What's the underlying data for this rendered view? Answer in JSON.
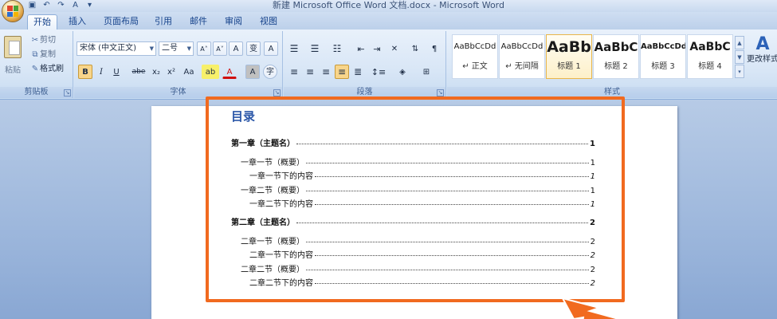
{
  "window": {
    "title": "新建 Microsoft Office Word 文档.docx - Microsoft Word"
  },
  "qat": [
    {
      "icon": "save-icon",
      "glyph": "▣"
    },
    {
      "icon": "undo-icon",
      "glyph": "↶"
    },
    {
      "icon": "redo-icon",
      "glyph": "↷"
    },
    {
      "icon": "spelling-icon",
      "glyph": "A"
    },
    {
      "icon": "customize-icon",
      "glyph": "▾"
    }
  ],
  "tabs": [
    {
      "label": "开始"
    },
    {
      "label": "插入"
    },
    {
      "label": "页面布局"
    },
    {
      "label": "引用"
    },
    {
      "label": "邮件"
    },
    {
      "label": "审阅"
    },
    {
      "label": "视图"
    }
  ],
  "clipboard": {
    "paste": "粘贴",
    "cut": "剪切",
    "copy": "复制",
    "format_painter": "格式刷",
    "label": "剪贴板"
  },
  "font": {
    "name": "宋体 (中文正文)",
    "size": "二号",
    "label": "字体",
    "buttons": {
      "grow": "A˄",
      "shrink": "A˅",
      "clear": "A",
      "phonetic": "变",
      "border": "A",
      "bold": "B",
      "italic": "I",
      "underline": "U",
      "strike": "abe",
      "sub": "x₂",
      "sup": "x²",
      "case": "Aa",
      "highlight": "ab",
      "color": "A",
      "shade": "A",
      "circle": "字"
    }
  },
  "paragraph": {
    "label": "段落"
  },
  "styles": {
    "label": "样式",
    "items": [
      {
        "preview": "AaBbCcDd",
        "name": "↵ 正文"
      },
      {
        "preview": "AaBbCcDd",
        "name": "↵ 无间隔"
      },
      {
        "preview": "AaBb",
        "name": "标题 1"
      },
      {
        "preview": "AaBbC",
        "name": "标题 2"
      },
      {
        "preview": "AaBbCcDd",
        "name": "标题 3"
      },
      {
        "preview": "AaBbC",
        "name": "标题 4"
      }
    ],
    "change_styles": "更改样式"
  },
  "document": {
    "toc_title": "目录",
    "entries": [
      {
        "level": 1,
        "text": "第一章（主题名）",
        "page": "1"
      },
      {
        "level": 2,
        "text": "一章一节（概要）",
        "page": "1"
      },
      {
        "level": 3,
        "text": "一章一节下的内容",
        "page": "1"
      },
      {
        "level": 2,
        "text": "一章二节（概要）",
        "page": "1"
      },
      {
        "level": 3,
        "text": "一章二节下的内容",
        "page": "1"
      },
      {
        "level": 1,
        "text": "第二章（主题名）",
        "page": "2"
      },
      {
        "level": 2,
        "text": "二章一节（概要）",
        "page": "2"
      },
      {
        "level": 3,
        "text": "二章一节下的内容",
        "page": "2"
      },
      {
        "level": 2,
        "text": "二章二节（概要）",
        "page": "2"
      },
      {
        "level": 3,
        "text": "二章二节下的内容",
        "page": "2"
      }
    ]
  },
  "colors": {
    "accent": "#f16a1f",
    "title_blue": "#2a56a8",
    "ribbon": "#d8e6f6"
  }
}
